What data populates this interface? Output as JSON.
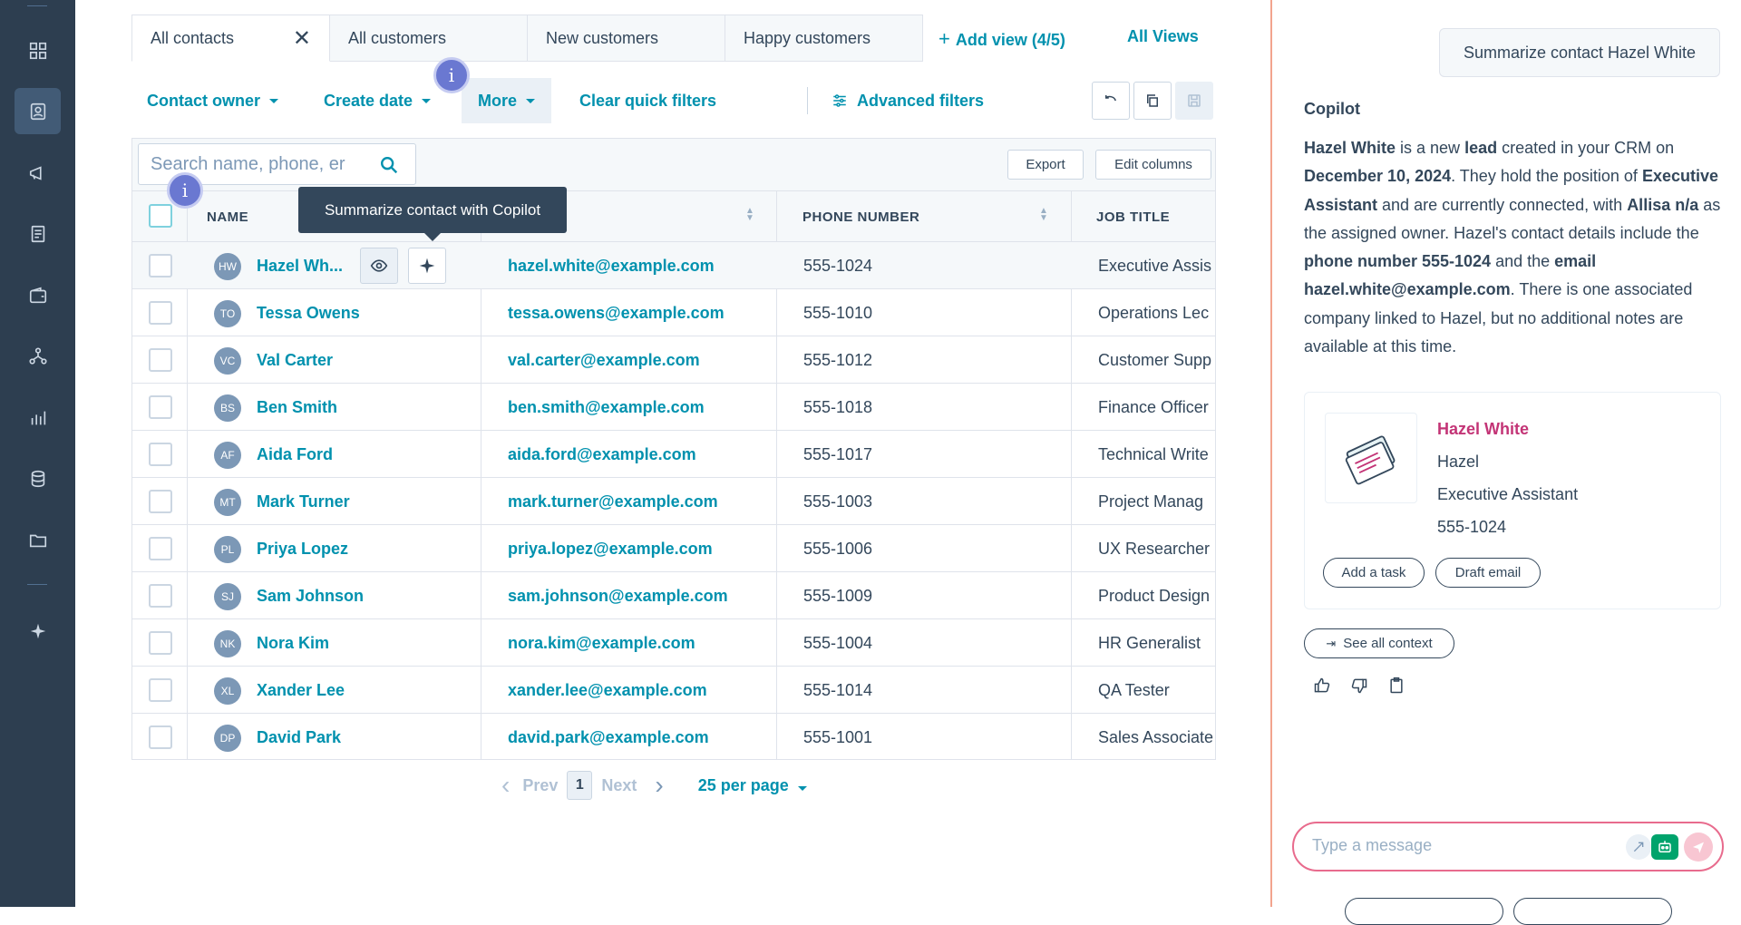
{
  "nav": {
    "icons": [
      "grid-icon",
      "contacts-icon",
      "megaphone-icon",
      "document-icon",
      "wallet-icon",
      "network-icon",
      "bar-chart-icon",
      "database-icon",
      "folder-icon",
      "sparkle-icon"
    ],
    "active": "contacts-icon"
  },
  "tabs": [
    {
      "label": "All contacts",
      "closable": true
    },
    {
      "label": "All customers"
    },
    {
      "label": "New customers"
    },
    {
      "label": "Happy customers"
    }
  ],
  "add_view": "Add view (4/5)",
  "all_views": "All Views",
  "filters": {
    "contact_owner": "Contact owner",
    "create_date": "Create date",
    "more": "More",
    "clear": "Clear quick filters",
    "advanced": "Advanced filters"
  },
  "toolbar": {
    "search_placeholder": "Search name, phone, er",
    "export": "Export",
    "edit_columns": "Edit columns"
  },
  "tooltip": "Summarize contact with Copilot",
  "badge": "i",
  "columns": {
    "name": "NAME",
    "phone": "PHONE NUMBER",
    "job": "JOB TITLE"
  },
  "rows": [
    {
      "initials": "HW",
      "name": "Hazel Wh...",
      "email": "hazel.white@example.com",
      "phone": "555-1024",
      "job": "Executive Assis"
    },
    {
      "initials": "TO",
      "name": "Tessa Owens",
      "email": "tessa.owens@example.com",
      "phone": "555-1010",
      "job": "Operations Lec"
    },
    {
      "initials": "VC",
      "name": "Val Carter",
      "email": "val.carter@example.com",
      "phone": "555-1012",
      "job": "Customer Supp"
    },
    {
      "initials": "BS",
      "name": "Ben Smith",
      "email": "ben.smith@example.com",
      "phone": "555-1018",
      "job": "Finance Officer"
    },
    {
      "initials": "AF",
      "name": "Aida Ford",
      "email": "aida.ford@example.com",
      "phone": "555-1017",
      "job": "Technical Write"
    },
    {
      "initials": "MT",
      "name": "Mark Turner",
      "email": "mark.turner@example.com",
      "phone": "555-1003",
      "job": "Project Manag"
    },
    {
      "initials": "PL",
      "name": "Priya Lopez",
      "email": "priya.lopez@example.com",
      "phone": "555-1006",
      "job": "UX Researcher"
    },
    {
      "initials": "SJ",
      "name": "Sam Johnson",
      "email": "sam.johnson@example.com",
      "phone": "555-1009",
      "job": "Product Design"
    },
    {
      "initials": "NK",
      "name": "Nora Kim",
      "email": "nora.kim@example.com",
      "phone": "555-1004",
      "job": "HR Generalist"
    },
    {
      "initials": "XL",
      "name": "Xander Lee",
      "email": "xander.lee@example.com",
      "phone": "555-1014",
      "job": "QA Tester"
    },
    {
      "initials": "DP",
      "name": "David Park",
      "email": "david.park@example.com",
      "phone": "555-1001",
      "job": "Sales Associate"
    }
  ],
  "pager": {
    "prev": "Prev",
    "page": "1",
    "next": "Next",
    "per_page": "25 per page"
  },
  "copilot": {
    "user_message": "Summarize contact Hazel White",
    "title": "Copilot",
    "card": {
      "name": "Hazel White",
      "first": "Hazel",
      "job": "Executive Assistant",
      "phone": "555-1024",
      "add_task": "Add a task",
      "draft_email": "Draft email"
    },
    "see_all": "See all context",
    "input_placeholder": "Type a message"
  },
  "colors": {
    "accent": "#0091ae",
    "nav": "#2d3e50",
    "pink": "#c33476",
    "badge": "#6a78d1"
  }
}
